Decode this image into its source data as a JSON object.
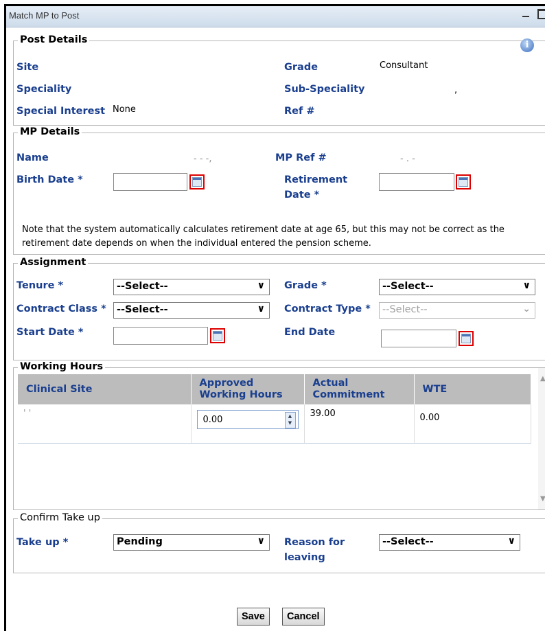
{
  "window": {
    "title": "Match MP to Post"
  },
  "post_details": {
    "legend": "Post Details",
    "site_label": "Site",
    "grade_label": "Grade",
    "grade_value": "Consultant",
    "speciality_label": "Speciality",
    "sub_speciality_label": "Sub-Speciality",
    "sub_speciality_value": ",",
    "special_interest_label": "Special Interest",
    "special_interest_value": "None",
    "ref_label": "Ref #",
    "info_icon_glyph": "i"
  },
  "mp_details": {
    "legend": "MP Details",
    "name_label": "Name",
    "name_value": "- - -,",
    "mp_ref_label": "MP Ref #",
    "mp_ref_value": "- . -",
    "birth_date_label": "Birth Date *",
    "birth_date_value": "",
    "retirement_date_label_1": "Retirement",
    "retirement_date_label_2": "Date *",
    "retirement_date_value": "",
    "note": "Note that the system automatically calculates retirement date at age 65, but this may not be correct as the retirement date depends on when the individual entered the pension scheme."
  },
  "assignment": {
    "legend": "Assignment",
    "tenure_label": "Tenure *",
    "tenure_value": "--Select--",
    "grade_label": "Grade *",
    "grade_value": "--Select--",
    "contract_class_label": "Contract Class *",
    "contract_class_value": "--Select--",
    "contract_type_label": "Contract Type *",
    "contract_type_value": "--Select--",
    "start_date_label": "Start Date *",
    "start_date_value": "",
    "end_date_label": "End Date",
    "end_date_value": ""
  },
  "working_hours": {
    "legend": "Working Hours",
    "columns": [
      "Clinical Site",
      "Approved Working Hours",
      "Actual Commitment",
      "WTE"
    ],
    "col2_line1": "Approved",
    "col2_line2": "Working Hours",
    "col3_line1": "Actual",
    "col3_line2": "Commitment",
    "rows": [
      {
        "clinical_site": "' '",
        "approved_hours": "0.00",
        "actual_commitment": "39.00",
        "wte": "0.00"
      }
    ]
  },
  "confirm_take_up": {
    "legend": "Confirm Take up",
    "take_up_label": "Take up *",
    "take_up_value": "Pending",
    "reason_label_1": "Reason for",
    "reason_label_2": "leaving",
    "reason_value": "--Select--"
  },
  "buttons": {
    "save": "Save",
    "cancel": "Cancel"
  }
}
